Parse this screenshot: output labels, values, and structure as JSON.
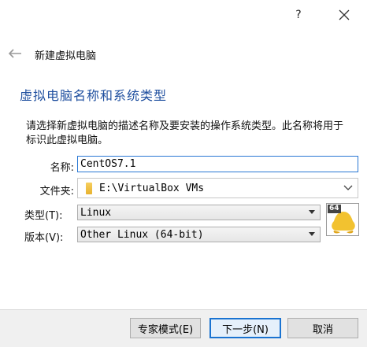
{
  "titlebar": {
    "help_label": "?",
    "close_icon": "close-icon"
  },
  "wizard": {
    "back_icon": "back-arrow-icon",
    "title": "新建虚拟电脑"
  },
  "page": {
    "heading": "虚拟电脑名称和系统类型",
    "description": "请选择新虚拟电脑的描述名称及要安装的操作系统类型。此名称将用于标识此虚拟电脑。"
  },
  "form": {
    "name_label": "名称:",
    "name_value": "CentOS7.1",
    "folder_label": "文件夹:",
    "folder_value": "E:\\VirtualBox VMs",
    "type_label": "类型(T):",
    "type_value": "Linux",
    "version_label": "版本(V):",
    "version_value": "Other Linux (64-bit)",
    "os_icon_badge": "64",
    "os_icon": "linux-penguin-64-icon"
  },
  "buttons": {
    "expert": "专家模式(E)",
    "next": "下一步(N)",
    "cancel": "取消"
  },
  "colors": {
    "heading": "#1f4f9f",
    "focus_border": "#2a78d4",
    "default_button_border": "#1a73d1"
  }
}
